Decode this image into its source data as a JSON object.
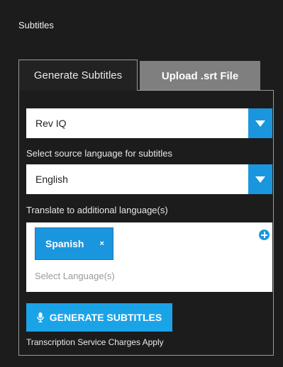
{
  "section": {
    "title": "Subtitles"
  },
  "tabs": [
    {
      "label": "Generate Subtitles",
      "active": true
    },
    {
      "label": "Upload .srt File",
      "active": false
    }
  ],
  "service_select": {
    "value": "Rev IQ"
  },
  "source_language": {
    "label": "Select source language for subtitles",
    "value": "English"
  },
  "translate": {
    "label": "Translate to additional language(s)",
    "chips": [
      {
        "label": "Spanish",
        "remove": "×"
      }
    ],
    "placeholder": "Select Language(s)"
  },
  "generate_button": {
    "label": "GENERATE SUBTITLES",
    "icon": "microphone-icon"
  },
  "note": "Transcription Service Charges Apply",
  "colors": {
    "accent": "#1a96de",
    "background": "#1c1c1c",
    "inactive_tab": "#7f7f7f"
  }
}
